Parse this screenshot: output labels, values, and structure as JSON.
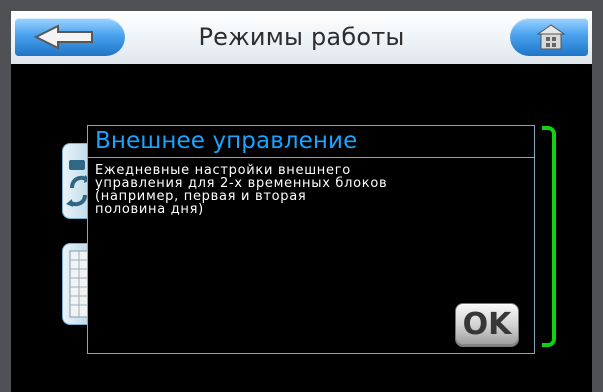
{
  "header": {
    "title": "Режимы работы",
    "back_icon": "back-arrow-icon",
    "home_icon": "home-icon"
  },
  "dialog": {
    "title": "Внешнее управление",
    "body": "Ежедневные настройки внешнего\nуправления для 2-х временных блоков\n(например, первая и вторая\nполовина дня)",
    "ok_label": "OK"
  },
  "background_tiles": [
    {
      "name": "auto",
      "icon": "auto-mode-icon"
    },
    {
      "name": "table",
      "icon": "table-icon"
    }
  ],
  "colors": {
    "accent_blue": "#1aa3ff",
    "header_bg": "#f4f7fa",
    "button_blue": "#4aa2ef",
    "selection_green": "#12d012"
  }
}
